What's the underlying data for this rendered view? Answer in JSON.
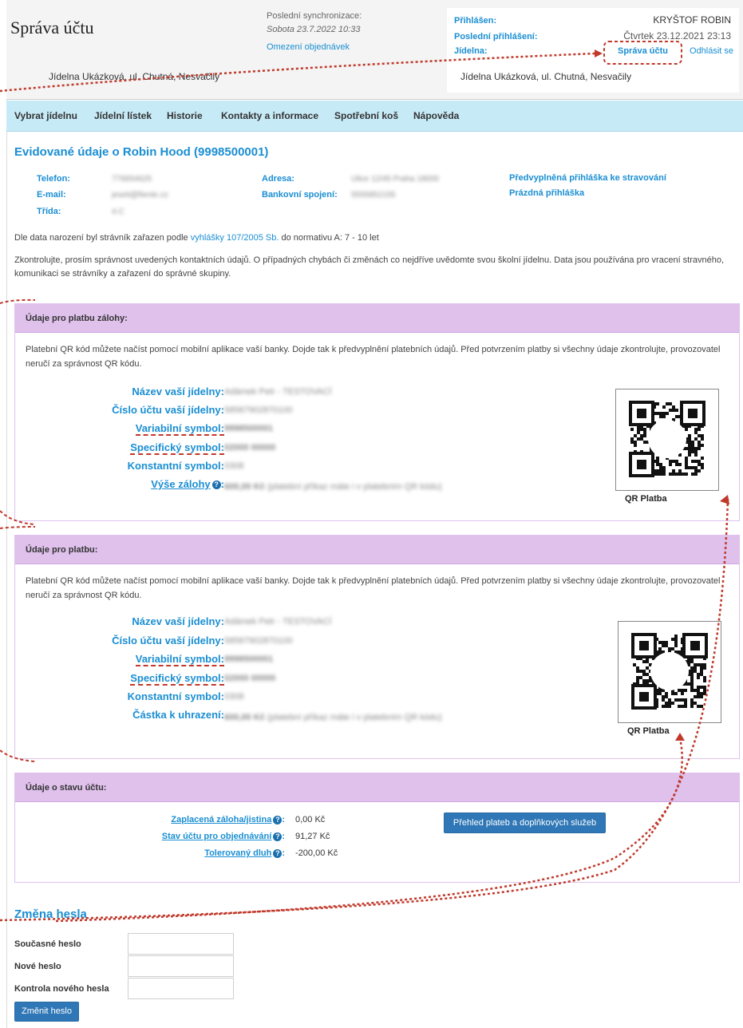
{
  "header": {
    "title": "Správa účtu",
    "sync_label": "Poslední synchronizace:",
    "sync_date": "Sobota 23.7.2022 10:33",
    "order_limit_link": "Omezení objednávek",
    "canteen_left": "Jídelna Ukázková, ul. Chutná, Nesvačily",
    "logged_label": "Přihlášen:",
    "logged_value": "KRYŠTOF ROBIN",
    "last_login_label": "Poslední přihlášení:",
    "last_login_value": "Čtvrtek 23.12.2021 23:13",
    "canteen_label": "Jídelna:",
    "account_link": "Správa účtu",
    "logout_link": "Odhlásit se",
    "canteen_right": "Jídelna Ukázková, ul. Chutná, Nesvačily"
  },
  "nav": [
    "Vybrat jídelnu",
    "Jídelní lístek",
    "Historie",
    "Kontakty a informace",
    "Spotřební koš",
    "Nápověda"
  ],
  "info": {
    "heading": "Evidované údaje o Robin Hood (9998500001)",
    "phone_label": "Telefon:",
    "phone_value": "776654625",
    "email_label": "E-mail:",
    "email_value": "jeseti@fiente.cz",
    "class_label": "Třída:",
    "class_value": "4.C",
    "address_label": "Adresa:",
    "address_value": "Ulice 12/45 Praha 18000",
    "bank_label": "Bankovní spojení:",
    "bank_value": "5555852155",
    "link_prefilled": "Předvyplněná přihláška ke stravování",
    "link_empty": "Prázdná přihláška",
    "norm_before": "Dle data narození byl strávník zařazen podle ",
    "norm_link": "vyhlášky 107/2005 Sb.",
    "norm_after": " do normativu A: 7 - 10 let",
    "check_text": "Zkontrolujte, prosím správnost uvedených kontaktních údajů. O případných chybách či změnách co nejdříve uvědomte svou školní jídelnu. Data jsou používána pro vracení stravného, komunikaci se strávníky a zařazení do správné skupiny."
  },
  "deposit": {
    "heading": "Údaje pro platbu zálohy:",
    "text": "Platební QR kód můžete načíst pomocí mobilní aplikace vaší banky. Dojde tak k předvyplnění platebních údajů. Před potvrzením platby si všechny údaje zkontrolujte, provozovatel neručí za správnost QR kódu.",
    "canteen_name_label": "Název vaší jídelny:",
    "canteen_name_value": "Adámek Petr - TESTOVACÍ",
    "account_label": "Číslo účtu vaší jídelny:",
    "account_value": "58587902870100",
    "var_label": "Variabilní symbol:",
    "var_value": "9998500001",
    "spec_label": "Specifický symbol:",
    "spec_value": "02000 00000",
    "const_label": "Konstantní symbol:",
    "const_value": "0308",
    "amount_label": "Výše zálohy",
    "amount_value": "600,00 Kč",
    "amount_note": "(platební příkaz máte i v platebním QR kódu)",
    "qr_caption": "QR Platba"
  },
  "payment": {
    "heading": "Údaje pro platbu:",
    "text": "Platební QR kód můžete načíst pomocí mobilní aplikace vaší banky. Dojde tak k předvyplnění platebních údajů. Před potvrzením platby si všechny údaje zkontrolujte, provozovatel neručí za správnost QR kódu.",
    "canteen_name_label": "Název vaší jídelny:",
    "canteen_name_value": "Adámek Petr - TESTOVACÍ",
    "account_label": "Číslo účtu vaší jídelny:",
    "account_value": "58587902870100",
    "var_label": "Variabilní symbol:",
    "var_value": "9998500001",
    "spec_label": "Specifický symbol:",
    "spec_value": "02000 00000",
    "const_label": "Konstantní symbol:",
    "const_value": "0308",
    "amount_label": "Částka k uhrazení:",
    "amount_value": "600,00 Kč",
    "amount_note": "(platební příkaz máte i v platebním QR kódu)",
    "qr_caption": "QR Platba"
  },
  "status": {
    "heading": "Údaje o stavu účtu:",
    "paid_label": "Zaplacená záloha/jistina",
    "paid_value": "0,00 Kč",
    "balance_label": "Stav účtu pro objednávání",
    "balance_value": "91,27 Kč",
    "debt_label": "Tolerovaný dluh",
    "debt_value": "-200,00 Kč",
    "overview_button": "Přehled plateb a doplňkových služeb"
  },
  "password": {
    "heading": "Změna hesla",
    "current_label": "Současné heslo",
    "new_label": "Nové heslo",
    "confirm_label": "Kontrola nového hesla",
    "submit": "Změnit heslo"
  },
  "colors": {
    "accent": "#1a8ed2",
    "nav_bg": "#c7eaf7",
    "panel_header": "#dfc1ec",
    "annotation": "#c0392b"
  }
}
